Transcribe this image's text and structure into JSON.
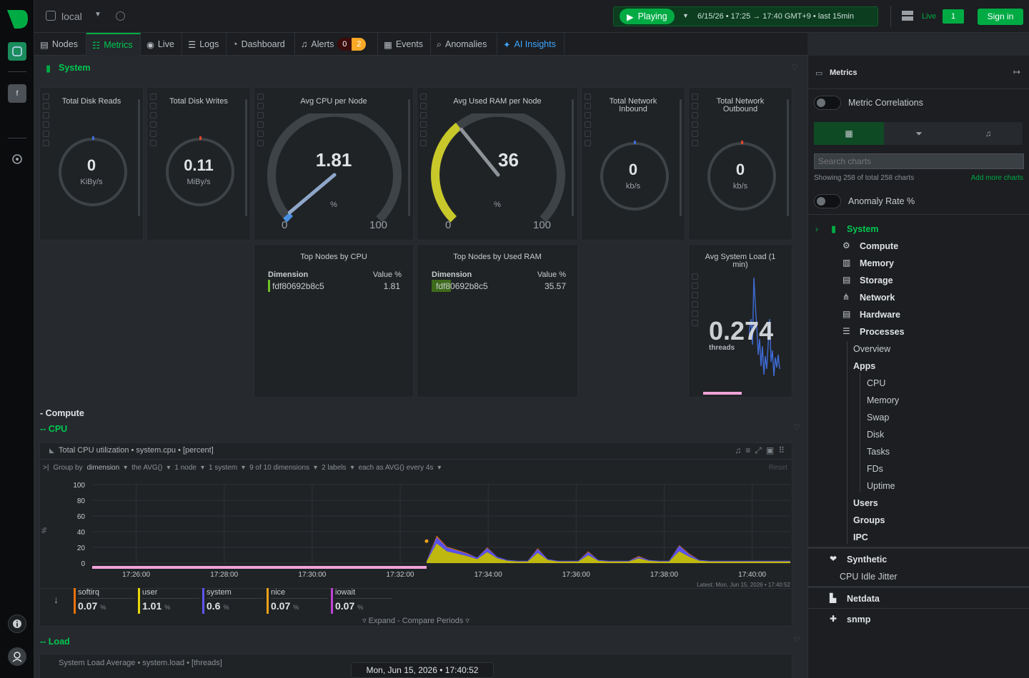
{
  "leftbar": {
    "space_initial": "f"
  },
  "topbar": {
    "space_name": "local",
    "play_label": "Playing",
    "time_range": "6/15/26 • 17:25 → 17:40 GMT+9 • last 15min",
    "live_label": "Live",
    "live_count": "1",
    "signin_label": "Sign in"
  },
  "tabs": [
    {
      "label": "Nodes"
    },
    {
      "label": "Metrics"
    },
    {
      "label": "Live"
    },
    {
      "label": "Logs"
    },
    {
      "label": "Dashboard"
    },
    {
      "label": "Alerts"
    },
    {
      "label": "Events"
    },
    {
      "label": "Anomalies"
    },
    {
      "label": "AI Insights"
    }
  ],
  "alerts": {
    "critical": "0",
    "warning": "2"
  },
  "system": {
    "heading": "System"
  },
  "gauges": {
    "disk_reads": {
      "title": "Total Disk Reads",
      "value": "0",
      "unit": "KiBy/s"
    },
    "disk_writes": {
      "title": "Total Disk Writes",
      "value": "0.11",
      "unit": "MiBy/s"
    },
    "cpu": {
      "title": "Avg CPU per Node",
      "value": "1.81",
      "unit": "%",
      "min": "0",
      "max": "100",
      "level": 1.81
    },
    "ram": {
      "title": "Avg Used RAM per Node",
      "value": "36",
      "unit": "%",
      "min": "0",
      "max": "100",
      "level": 35.57
    },
    "net_in": {
      "title": "Total Network Inbound",
      "value": "0",
      "unit": "kb/s"
    },
    "net_out": {
      "title": "Total Network Outbound",
      "value": "0",
      "unit": "kb/s"
    }
  },
  "top_cpu": {
    "title": "Top Nodes by CPU",
    "col1": "Dimension",
    "col2": "Value %",
    "node": "fdf80692b8c5",
    "value": "1.81"
  },
  "top_ram": {
    "title": "Top Nodes by Used RAM",
    "col1": "Dimension",
    "col2": "Value %",
    "node": "fdf80692b8c5",
    "value": "35.57"
  },
  "load_card": {
    "title": "Avg System Load (1 min)",
    "value": "0.274",
    "unit": "threads"
  },
  "sections": {
    "compute": "- Compute",
    "cpu": "-- CPU",
    "load": "-- Load"
  },
  "cpu_chart": {
    "title": "Total CPU utilization • system.cpu • [percent]",
    "filters": {
      "group": "Group by",
      "group_val": "dimension",
      "agg": "the AVG()",
      "nodes": "1 node",
      "systems": "1 system",
      "dims": "9 of 10 dimensions",
      "labels": "2 labels",
      "each": "each as AVG() every 4s",
      "reset": "Reset"
    },
    "ylabel": "%",
    "latest": "Latest: Mon, Jun 15, 2026 • 17:40:52",
    "expand": "Expand - Compare Periods",
    "legend": [
      {
        "name": "softirq",
        "value": "0.07",
        "unit": "%",
        "color": "#e8720c"
      },
      {
        "name": "user",
        "value": "1.01",
        "unit": "%",
        "color": "#e6d80a"
      },
      {
        "name": "system",
        "value": "0.6",
        "unit": "%",
        "color": "#5e55f6"
      },
      {
        "name": "nice",
        "value": "0.07",
        "unit": "%",
        "color": "#f0a21a"
      },
      {
        "name": "iowait",
        "value": "0.07",
        "unit": "%",
        "color": "#c042d6"
      }
    ]
  },
  "chart_data": {
    "type": "area",
    "title": "Total CPU utilization • system.cpu • [percent]",
    "ylabel": "%",
    "ylim": [
      0,
      100
    ],
    "yticks": [
      "100",
      "80",
      "60",
      "40",
      "20",
      "0"
    ],
    "xticks": [
      "17:26:00",
      "17:28:00",
      "17:30:00",
      "17:32:00",
      "17:34:00",
      "17:36:00",
      "17:38:00",
      "17:40:00"
    ],
    "x_range": [
      "17:25:00",
      "17:40:52"
    ],
    "data_start": "17:32:36",
    "series": [
      {
        "name": "user",
        "values": [
          2,
          25,
          15,
          12,
          9,
          5,
          14,
          6,
          3,
          2,
          2,
          13,
          4,
          2,
          2,
          2,
          10,
          3,
          2,
          2,
          2,
          6,
          3,
          2,
          2,
          15,
          8,
          3,
          2,
          2,
          2,
          2,
          2,
          2,
          2,
          2,
          2
        ]
      },
      {
        "name": "system",
        "values": [
          1,
          8,
          5,
          4,
          3,
          2,
          5,
          2,
          1,
          1,
          1,
          5,
          1,
          1,
          1,
          1,
          4,
          1,
          1,
          1,
          1,
          2,
          1,
          1,
          1,
          7,
          3,
          1,
          1,
          1,
          1,
          1,
          1,
          1,
          1,
          1,
          1
        ]
      },
      {
        "name": "softirq",
        "values": [
          0,
          2,
          1,
          1,
          1,
          0,
          1,
          0,
          0,
          0,
          0,
          1,
          0,
          0,
          0,
          0,
          1,
          0,
          0,
          0,
          0,
          1,
          0,
          0,
          0,
          1,
          1,
          0,
          0,
          0,
          0,
          0,
          0,
          0,
          0,
          0,
          0
        ]
      }
    ]
  },
  "load_section": {
    "title": "System Load Average • system.load • [threads]"
  },
  "footer": {
    "timestamp": "Mon, Jun 15, 2026 • 17:40:52"
  },
  "right": {
    "title": "Metrics",
    "metric_corr": "Metric Correlations",
    "search_placeholder": "Search charts",
    "showing": "Showing 258 of total 258 charts",
    "add_more": "Add more charts",
    "anomaly": "Anomaly Rate %",
    "tree": {
      "system": "System",
      "compute": "Compute",
      "memory": "Memory",
      "storage": "Storage",
      "network": "Network",
      "hardware": "Hardware",
      "processes": "Processes",
      "overview": "Overview",
      "apps": "Apps",
      "cpu": "CPU",
      "mem": "Memory",
      "swap": "Swap",
      "disk": "Disk",
      "tasks": "Tasks",
      "fds": "FDs",
      "uptime": "Uptime",
      "users": "Users",
      "groups": "Groups",
      "ipc": "IPC",
      "synthetic": "Synthetic",
      "jitter": "CPU Idle Jitter",
      "netdata": "Netdata",
      "snmp": "snmp"
    }
  },
  "colors": {
    "accent": "#00ab44",
    "bg": "#26292d",
    "panel": "#202326",
    "blue": "#3ea6ff"
  }
}
